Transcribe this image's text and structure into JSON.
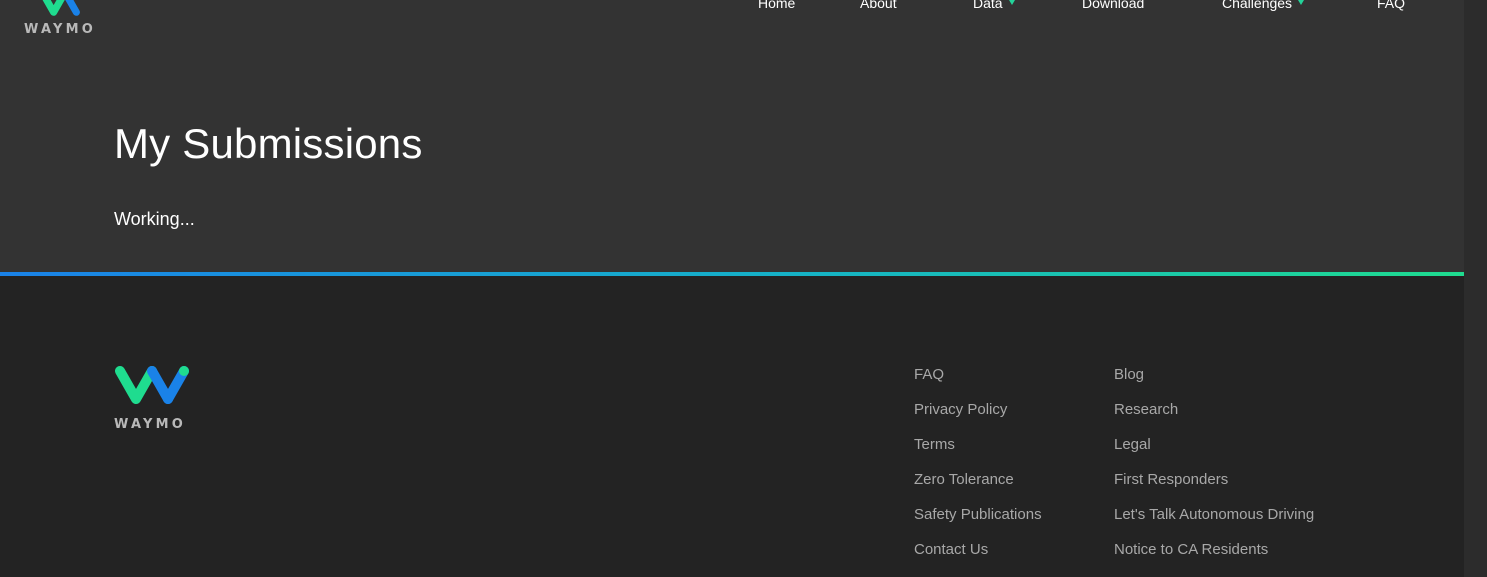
{
  "brand": {
    "name": "WAYMO"
  },
  "nav": {
    "items": [
      {
        "label": "Home"
      },
      {
        "label": "About"
      },
      {
        "label": "Data"
      },
      {
        "label": "Download"
      },
      {
        "label": "Challenges"
      },
      {
        "label": "FAQ"
      }
    ]
  },
  "main": {
    "title": "My Submissions",
    "status": "Working..."
  },
  "footer": {
    "col1": [
      "FAQ",
      "Privacy Policy",
      "Terms",
      "Zero Tolerance",
      "Safety Publications",
      "Contact Us"
    ],
    "col2": [
      "Blog",
      "Research",
      "Legal",
      "First Responders",
      "Let's Talk Autonomous Driving",
      "Notice to CA Residents"
    ]
  },
  "colors": {
    "accent_green": "#23d39a",
    "accent_blue": "#1a82e8",
    "header_bg": "#333333",
    "footer_bg": "#232323"
  }
}
